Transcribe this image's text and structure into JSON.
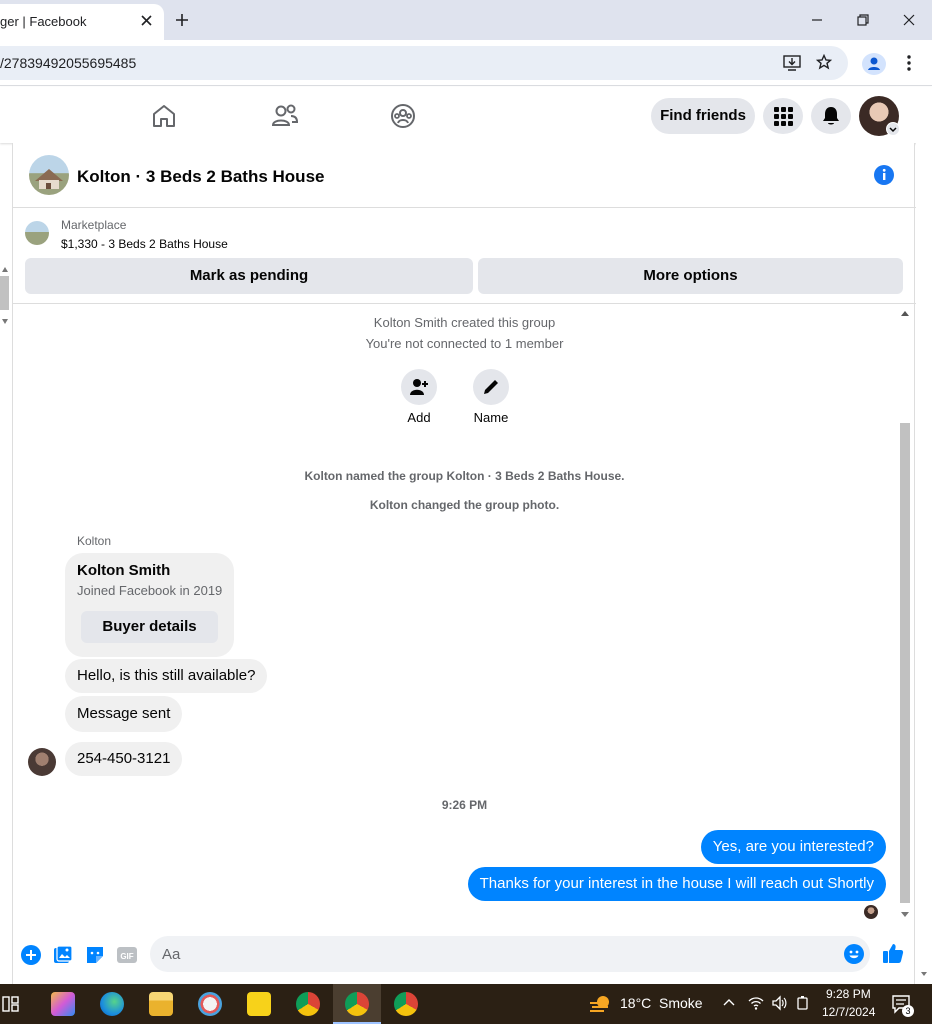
{
  "browser": {
    "tab_title": "ger | Facebook",
    "url": "/27839492055695485"
  },
  "nav": {
    "find_friends": "Find friends"
  },
  "chat": {
    "title": "Kolton · 3 Beds 2 Baths House",
    "marketplace": {
      "label": "Marketplace",
      "listing": "$1,330 - 3 Beds 2 Baths House",
      "pending_button": "Mark as pending",
      "more_button": "More options"
    },
    "system": {
      "created": "Kolton Smith created this group",
      "not_connected": "You're not connected to 1 member",
      "add_label": "Add",
      "name_label": "Name",
      "renamed": "Kolton named the group Kolton · 3 Beds 2 Baths House.",
      "photo_changed": "Kolton changed the group photo."
    },
    "sender_name": "Kolton",
    "card": {
      "name": "Kolton Smith",
      "subtitle": "Joined Facebook in 2019",
      "button": "Buyer details"
    },
    "messages_in": [
      "Hello, is this still available?",
      "Message sent",
      "254-450-3121"
    ],
    "timestamp": "9:26 PM",
    "messages_out": [
      "Yes, are you interested?",
      "Thanks for your interest in the house I will reach out Shortly"
    ],
    "composer_placeholder": "Aa"
  },
  "taskbar": {
    "temperature": "18°C",
    "condition": "Smoke",
    "time": "9:28 PM",
    "date": "12/7/2024",
    "notifications": "3"
  },
  "colors": {
    "accent": "#0084ff",
    "fb_blue": "#1877f2",
    "bubble_gray": "#f0f0f0",
    "taskbar": "#2b2014"
  }
}
